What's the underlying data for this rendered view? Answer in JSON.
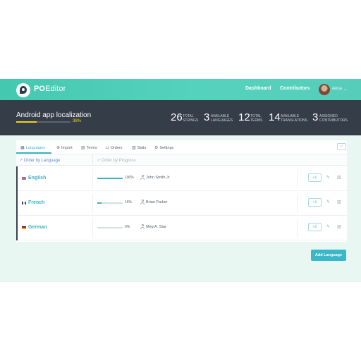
{
  "app": {
    "brand_part1": "PO",
    "brand_part2": "Editor",
    "nav": {
      "dashboard": "Dashboard",
      "contributors": "Contributors"
    },
    "user": {
      "name": "Anca",
      "chevron": "⌄"
    }
  },
  "project": {
    "title": "Android app localization",
    "progress_label": "38%",
    "progress_fraction": 0.38,
    "stats": [
      {
        "num": "26",
        "l1": "TOTAL",
        "l2": "STRINGS"
      },
      {
        "num": "3",
        "l1": "AVAILABLE",
        "l2": "LANGUAGES"
      },
      {
        "num": "12",
        "l1": "TOTAL",
        "l2": "TERMS"
      },
      {
        "num": "14",
        "l1": "AVAILABLE",
        "l2": "TRANSLATIONS"
      },
      {
        "num": "3",
        "l1": "ASSIGNED",
        "l2": "CONTRIBUTORS"
      }
    ],
    "accent_yellow": "#f3d21b"
  },
  "tabs": [
    {
      "label": "Languages",
      "icon": "grid-icon"
    },
    {
      "label": "Import",
      "icon": "upload-icon"
    },
    {
      "label": "Terms",
      "icon": "list-icon"
    },
    {
      "label": "Orders",
      "icon": "cart-icon"
    },
    {
      "label": "Stats",
      "icon": "bar-chart-icon"
    },
    {
      "label": "Settings",
      "icon": "gear-icon"
    }
  ],
  "sort": {
    "by_language": "Order by Language",
    "by_progress": "Order by Progress"
  },
  "languages": [
    {
      "name": "English",
      "progress_label": "100%",
      "progress": 1.0,
      "contributor": "John Smith Jr",
      "add_label": "+&",
      "flag": "uk-flag-icon"
    },
    {
      "name": "French",
      "progress_label": "16%",
      "progress": 0.16,
      "contributor": "Brian Parker",
      "add_label": "+&",
      "flag": "fr-flag-icon"
    },
    {
      "name": "German",
      "progress_label": "0%",
      "progress": 0.0,
      "contributor": "Meg A. Star",
      "add_label": "+&",
      "flag": "de-flag-icon"
    }
  ],
  "add_language_label": "Add Language",
  "colors": {
    "teal": "#3bb3c3",
    "dark": "#353d48",
    "header_green": "#4fcdb6"
  }
}
